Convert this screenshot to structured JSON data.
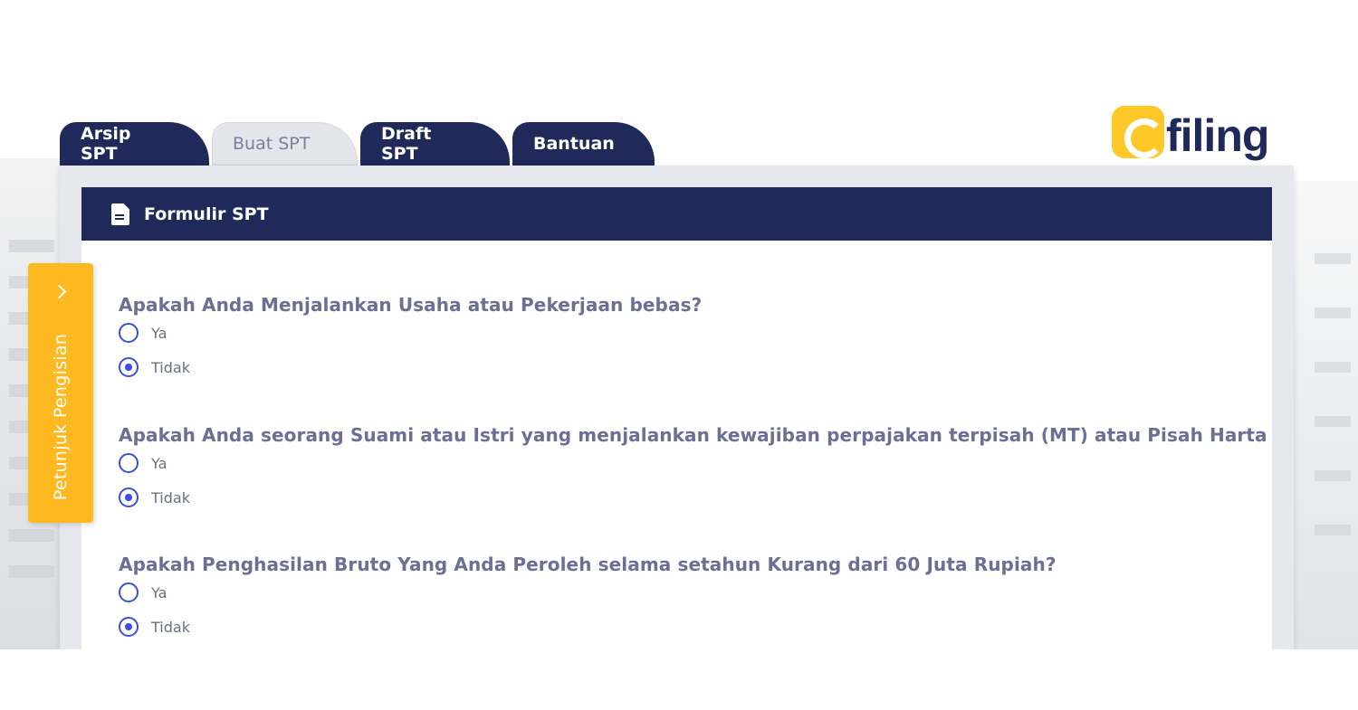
{
  "logo": {
    "text": "filing",
    "accent_color": "#ffc727",
    "brand_color": "#1f2a5a"
  },
  "tabs": [
    {
      "label": "Arsip SPT",
      "active": true
    },
    {
      "label": "Buat SPT",
      "active": false
    },
    {
      "label": "Draft SPT",
      "active": true
    },
    {
      "label": "Bantuan",
      "active": true
    }
  ],
  "card": {
    "title": "Formulir SPT",
    "icon": "document-icon"
  },
  "side_panel": {
    "label": "Petunjuk Pengisian",
    "icon": "chevron-right-icon",
    "color": "#ffb920"
  },
  "questions": [
    {
      "text": "Apakah Anda Menjalankan Usaha atau Pekerjaan bebas?",
      "options": [
        {
          "label": "Ya",
          "checked": false
        },
        {
          "label": "Tidak",
          "checked": true
        }
      ]
    },
    {
      "text": "Apakah Anda seorang Suami atau Istri yang menjalankan kewajiban perpajakan terpisah (MT) atau Pisah Harta (PH)?",
      "options": [
        {
          "label": "Ya",
          "checked": false
        },
        {
          "label": "Tidak",
          "checked": true
        }
      ]
    },
    {
      "text": "Apakah Penghasilan Bruto Yang Anda Peroleh selama setahun Kurang dari 60 Juta Rupiah?",
      "options": [
        {
          "label": "Ya",
          "checked": false
        },
        {
          "label": "Tidak",
          "checked": true
        }
      ]
    }
  ]
}
